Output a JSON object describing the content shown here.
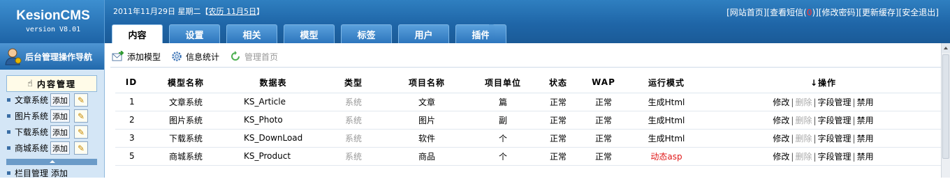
{
  "app": {
    "title": "KesionCMS",
    "version": "version V8.01"
  },
  "header": {
    "date": "2011年11月29日 星期二",
    "lunar_open": "【",
    "lunar_text": "农历 11月5日",
    "lunar_close": "】",
    "links": {
      "home": "[网站首页]",
      "sms_prefix": "[查看短信(",
      "sms_count": "0",
      "sms_suffix": ")]",
      "change_password": "[修改密码]",
      "refresh_cache": "[更新缓存]",
      "logout": "[安全退出]"
    }
  },
  "tabs": [
    "内容",
    "设置",
    "相关",
    "模型",
    "标签",
    "用户",
    "插件"
  ],
  "active_tab": "内容",
  "sidebar": {
    "nav_title": "后台管理操作导航",
    "section_title": "内容管理",
    "add_label": "添加",
    "items": [
      {
        "label": "文章系统"
      },
      {
        "label": "图片系统"
      },
      {
        "label": "下载系统"
      },
      {
        "label": "商城系统"
      }
    ],
    "column_label": "栏目管理",
    "column_add": "添加"
  },
  "toolbar": {
    "add_model": "添加模型",
    "info_stats": "信息统计",
    "manage_home": "管理首页"
  },
  "table": {
    "headers": [
      "ID",
      "模型名称",
      "数据表",
      "类型",
      "项目名称",
      "项目单位",
      "状态",
      "WAP",
      "运行模式",
      "↓操作"
    ],
    "rows": [
      {
        "id": "1",
        "name": "文章系统",
        "table": "KS_Article",
        "type": "系统",
        "item": "文章",
        "unit": "篇",
        "status": "正常",
        "wap": "正常",
        "mode": "生成Html"
      },
      {
        "id": "2",
        "name": "图片系统",
        "table": "KS_Photo",
        "type": "系统",
        "item": "图片",
        "unit": "副",
        "status": "正常",
        "wap": "正常",
        "mode": "生成Html"
      },
      {
        "id": "3",
        "name": "下载系统",
        "table": "KS_DownLoad",
        "type": "系统",
        "item": "软件",
        "unit": "个",
        "status": "正常",
        "wap": "正常",
        "mode": "生成Html"
      },
      {
        "id": "5",
        "name": "商城系统",
        "table": "KS_Product",
        "type": "系统",
        "item": "商品",
        "unit": "个",
        "status": "正常",
        "wap": "正常",
        "mode": "动态asp"
      }
    ],
    "ops": {
      "edit": "修改",
      "delete": "删除",
      "fields": "字段管理",
      "disable": "禁用",
      "sep": "|"
    }
  },
  "colors": {
    "header_blue": "#1f66a8",
    "red_mode": "#e01818",
    "disabled_gray": "#999999"
  }
}
